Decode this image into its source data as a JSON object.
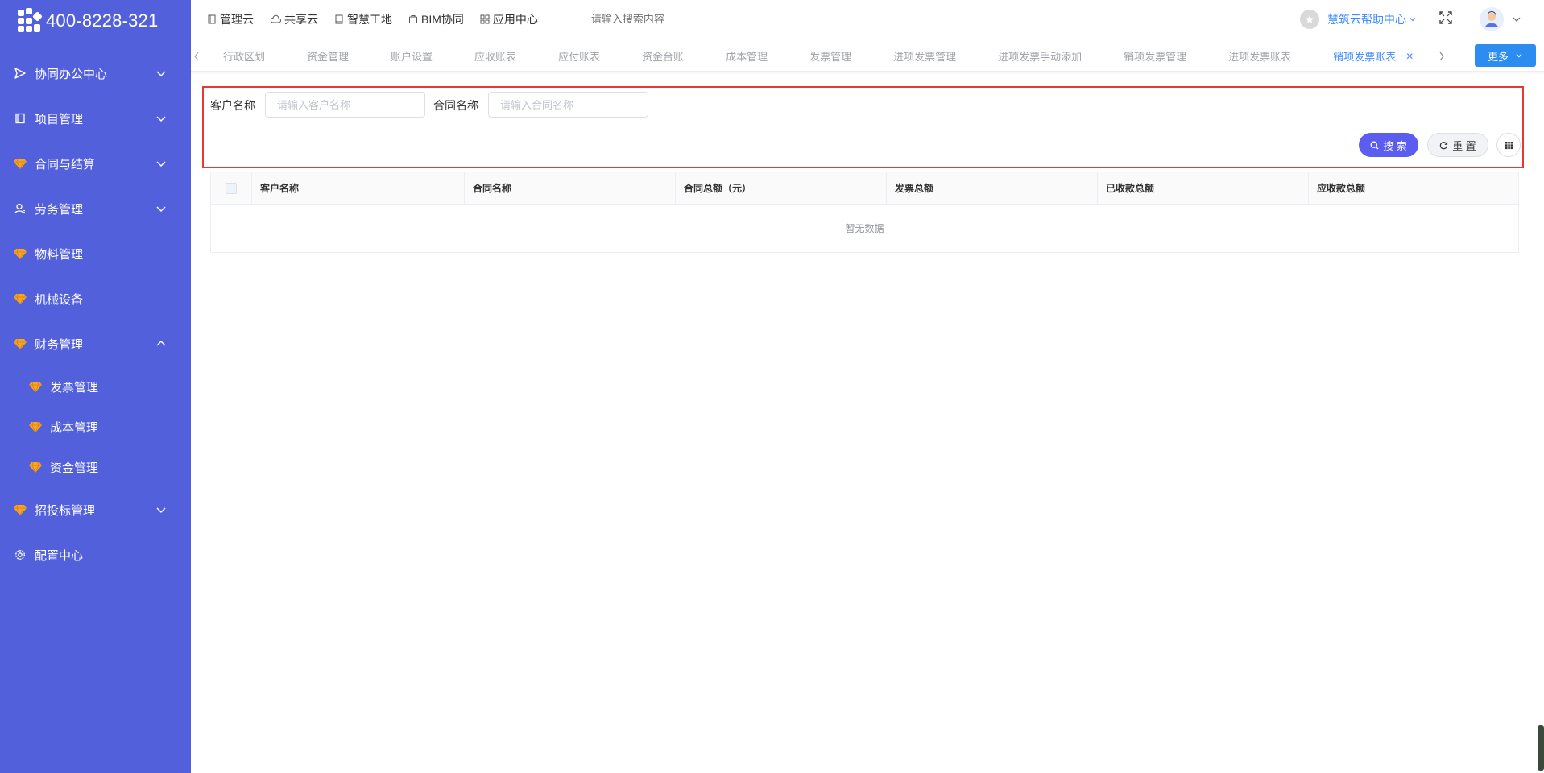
{
  "brand": {
    "phone": "400-8228-321"
  },
  "sidebar": {
    "items": [
      {
        "label": "协同办公中心",
        "icon": "send-icon",
        "expandable": true,
        "expanded": false
      },
      {
        "label": "项目管理",
        "icon": "book-icon",
        "expandable": true,
        "expanded": false
      },
      {
        "label": "合同与结算",
        "icon": "gem-icon",
        "expandable": true,
        "expanded": false
      },
      {
        "label": "劳务管理",
        "icon": "user-icon",
        "expandable": true,
        "expanded": false
      },
      {
        "label": "物料管理",
        "icon": "gem-icon",
        "expandable": false
      },
      {
        "label": "机械设备",
        "icon": "gem-icon",
        "expandable": false
      },
      {
        "label": "财务管理",
        "icon": "gem-icon",
        "expandable": true,
        "expanded": true
      },
      {
        "label": "招投标管理",
        "icon": "gem-icon",
        "expandable": true,
        "expanded": false
      },
      {
        "label": "配置中心",
        "icon": "gear-icon",
        "expandable": false
      }
    ],
    "finance_children": [
      {
        "label": "发票管理",
        "icon": "gem-icon"
      },
      {
        "label": "成本管理",
        "icon": "gem-icon"
      },
      {
        "label": "资金管理",
        "icon": "gem-icon"
      }
    ]
  },
  "topbar": {
    "nav": [
      {
        "label": "管理云",
        "icon": "doc-icon"
      },
      {
        "label": "共享云",
        "icon": "cloud-icon"
      },
      {
        "label": "智慧工地",
        "icon": "book-icon"
      },
      {
        "label": "BIM协同",
        "icon": "tag-icon"
      },
      {
        "label": "应用中心",
        "icon": "grid-icon"
      }
    ],
    "search_placeholder": "请输入搜索内容",
    "help_label": "慧筑云帮助中心"
  },
  "tabs": {
    "items": [
      "行政区划",
      "资金管理",
      "账户设置",
      "应收账表",
      "应付账表",
      "资金台账",
      "成本管理",
      "发票管理",
      "进项发票管理",
      "进项发票手动添加",
      "销项发票管理",
      "进项发票账表"
    ],
    "active": "销项发票账表",
    "more_label": "更多"
  },
  "filter": {
    "customer_label": "客户名称",
    "customer_placeholder": "请输入客户名称",
    "contract_label": "合同名称",
    "contract_placeholder": "请输入合同名称",
    "search_label": "搜 索",
    "reset_label": "重 置"
  },
  "table": {
    "columns": [
      "客户名称",
      "合同名称",
      "合同总额（元）",
      "发票总额",
      "已收款总额",
      "应收款总额"
    ],
    "empty_text": "暂无数据"
  },
  "colors": {
    "sidebar_bg": "#5360dc",
    "accent": "#3c8bff",
    "search_button": "#5b5cf0",
    "highlight_border": "#e53935",
    "gem": "#f5a623"
  }
}
